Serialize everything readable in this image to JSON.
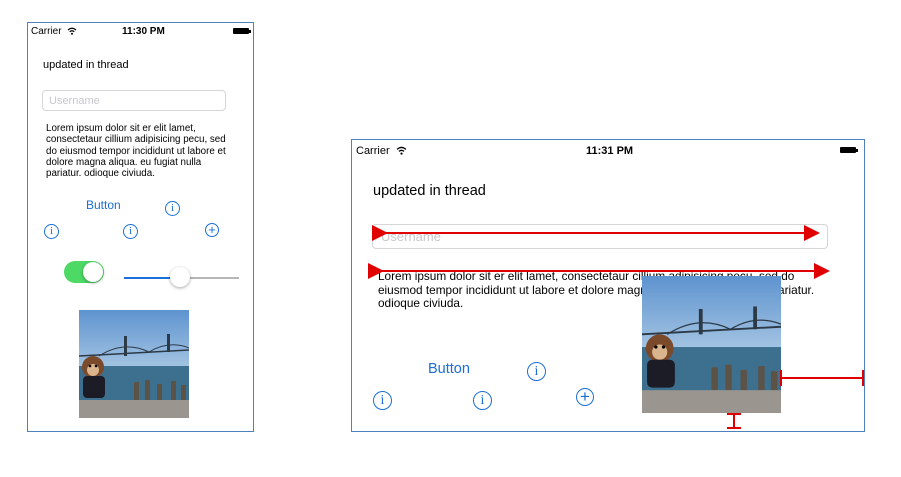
{
  "portrait": {
    "status": {
      "carrier": "Carrier",
      "time": "11:30 PM"
    },
    "label": "updated in thread",
    "username_placeholder": "Username",
    "lorem": "Lorem ipsum dolor sit er elit lamet, consectetaur cillium adipisicing pecu, sed do eiusmod tempor incididunt ut labore et dolore magna aliqua. eu fugiat nulla pariatur. odioque civiuda.",
    "button_label": "Button",
    "switch_on": true,
    "slider_value": 0.5
  },
  "landscape": {
    "status": {
      "carrier": "Carrier",
      "time": "11:31 PM"
    },
    "label": "updated in thread",
    "username_placeholder": "Username",
    "lorem": "Lorem ipsum dolor sit er elit lamet, consectetaur cillium adipisicing pecu, sed do eiusmod tempor incididunt ut labore et dolore magna aliqua. eu fugiat nulla pariatur. odioque civiuda.",
    "button_label": "Button"
  },
  "icons": {
    "info": "info-icon",
    "add": "add-contact-icon",
    "wifi": "wifi-icon",
    "battery": "battery-icon"
  },
  "colors": {
    "tint": "#1a6fd8",
    "switch_on": "#4cd964",
    "annotation": "#e00000",
    "frame": "#4f81bd"
  }
}
